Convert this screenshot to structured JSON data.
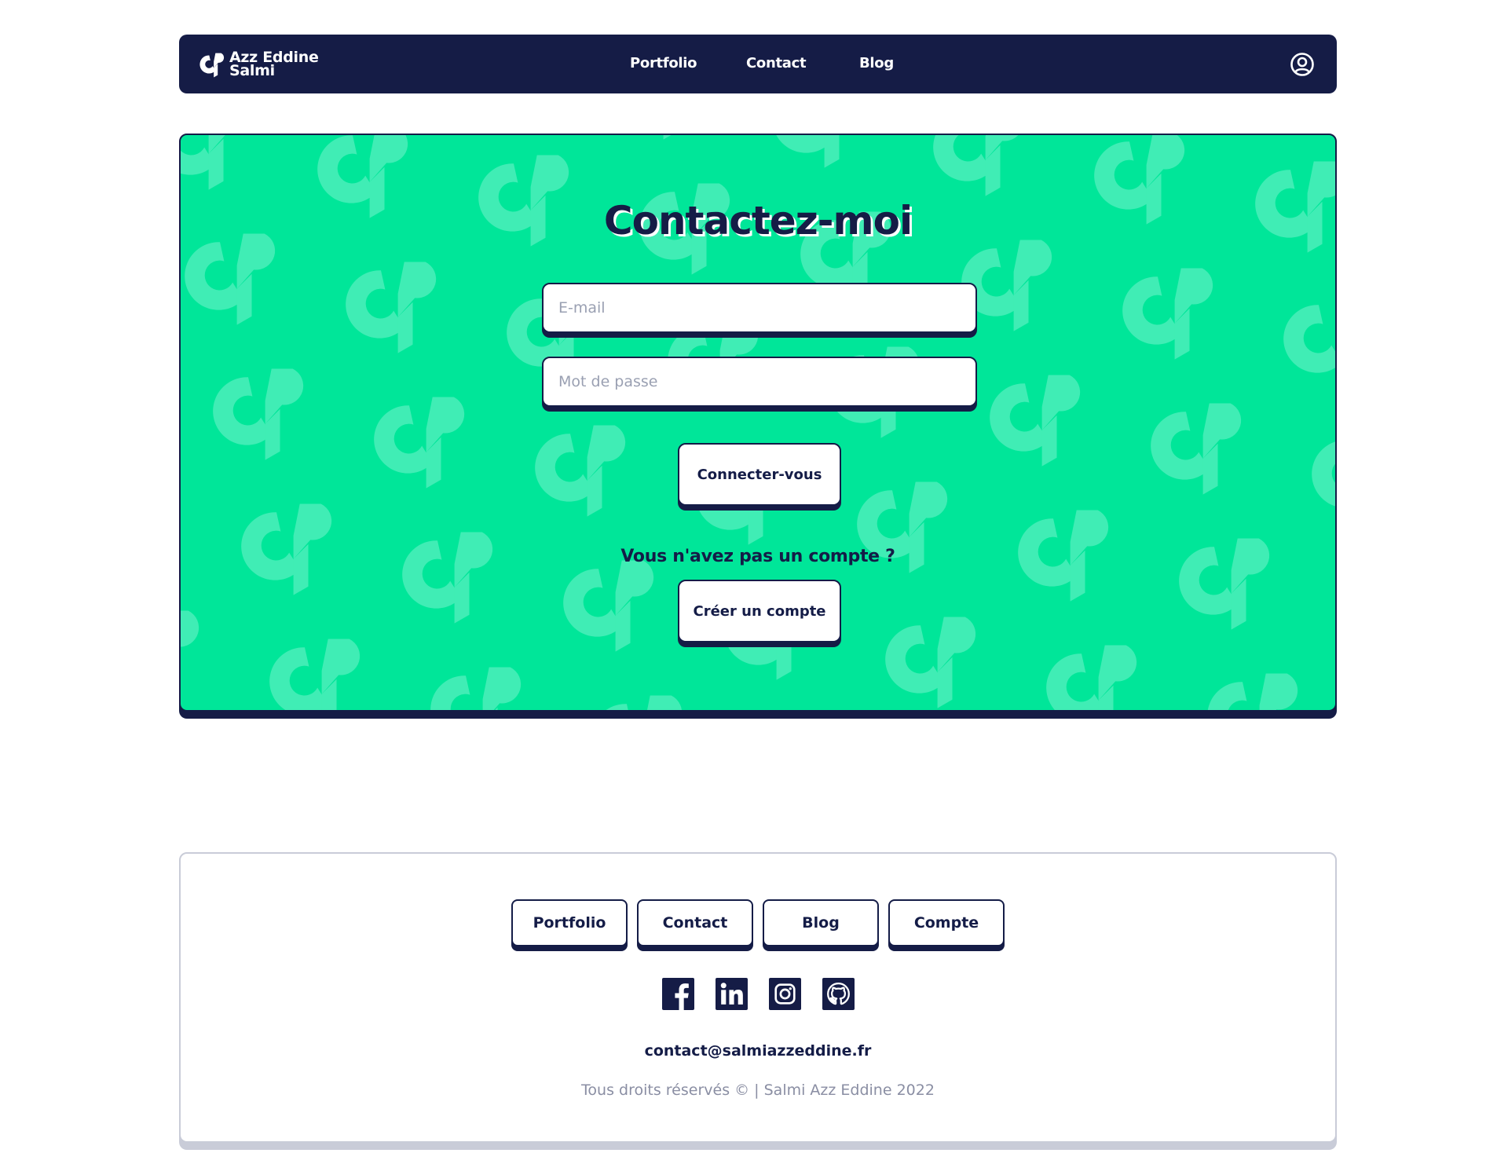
{
  "colors": {
    "navy": "#151c46",
    "green": "#00e699",
    "pattern": "#40edb5",
    "white": "#ffffff",
    "muted": "#8a8ea3"
  },
  "header": {
    "logo_line1": "Azz Eddine",
    "logo_line2": "Salmi",
    "logo_icon": "brand-mark-icon",
    "nav": [
      "Portfolio",
      "Contact",
      "Blog"
    ],
    "account_icon": "user-circle-icon"
  },
  "hero": {
    "title": "Contactez-moi",
    "email_placeholder": "E-mail",
    "password_placeholder": "Mot de passe",
    "login_button": "Connecter-vous",
    "no_account_text": "Vous n'avez pas un compte ?",
    "signup_button": "Créer un compte"
  },
  "footer": {
    "nav": [
      "Portfolio",
      "Contact",
      "Blog",
      "Compte"
    ],
    "socials": [
      "facebook-icon",
      "linkedin-icon",
      "instagram-icon",
      "github-icon"
    ],
    "email": "contact@salmiazzeddine.fr",
    "copyright": "Tous droits réservés © | Salmi Azz Eddine 2022"
  }
}
